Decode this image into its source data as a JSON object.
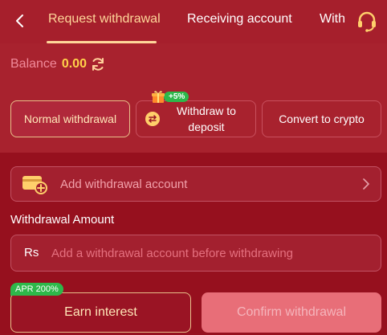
{
  "header": {
    "tabs": [
      {
        "label": "Request withdrawal",
        "active": true
      },
      {
        "label": "Receiving account",
        "active": false
      },
      {
        "label": "Withdrawal history",
        "active": false
      }
    ]
  },
  "balance": {
    "label": "Balance",
    "value": "0.00"
  },
  "options": {
    "normal": "Normal withdrawal",
    "deposit": "Withdraw to deposit",
    "deposit_badge": "+5%",
    "crypto": "Convert to crypto"
  },
  "account": {
    "add_label": "Add withdrawal account"
  },
  "amount": {
    "title": "Withdrawal Amount",
    "currency": "Rs",
    "placeholder": "Add a withdrawal account before withdrawing"
  },
  "actions": {
    "apr_badge": "APR 200%",
    "earn": "Earn interest",
    "confirm": "Confirm withdrawal"
  },
  "colors": {
    "accent": "#ffd79a",
    "badge_green": "#2eb84a",
    "balance_value": "#ffd24a"
  },
  "icons": [
    "back-chevron-icon",
    "headset-icon",
    "refresh-icon",
    "exchange-icon",
    "gift-icon",
    "card-icon",
    "chevron-right-icon"
  ]
}
